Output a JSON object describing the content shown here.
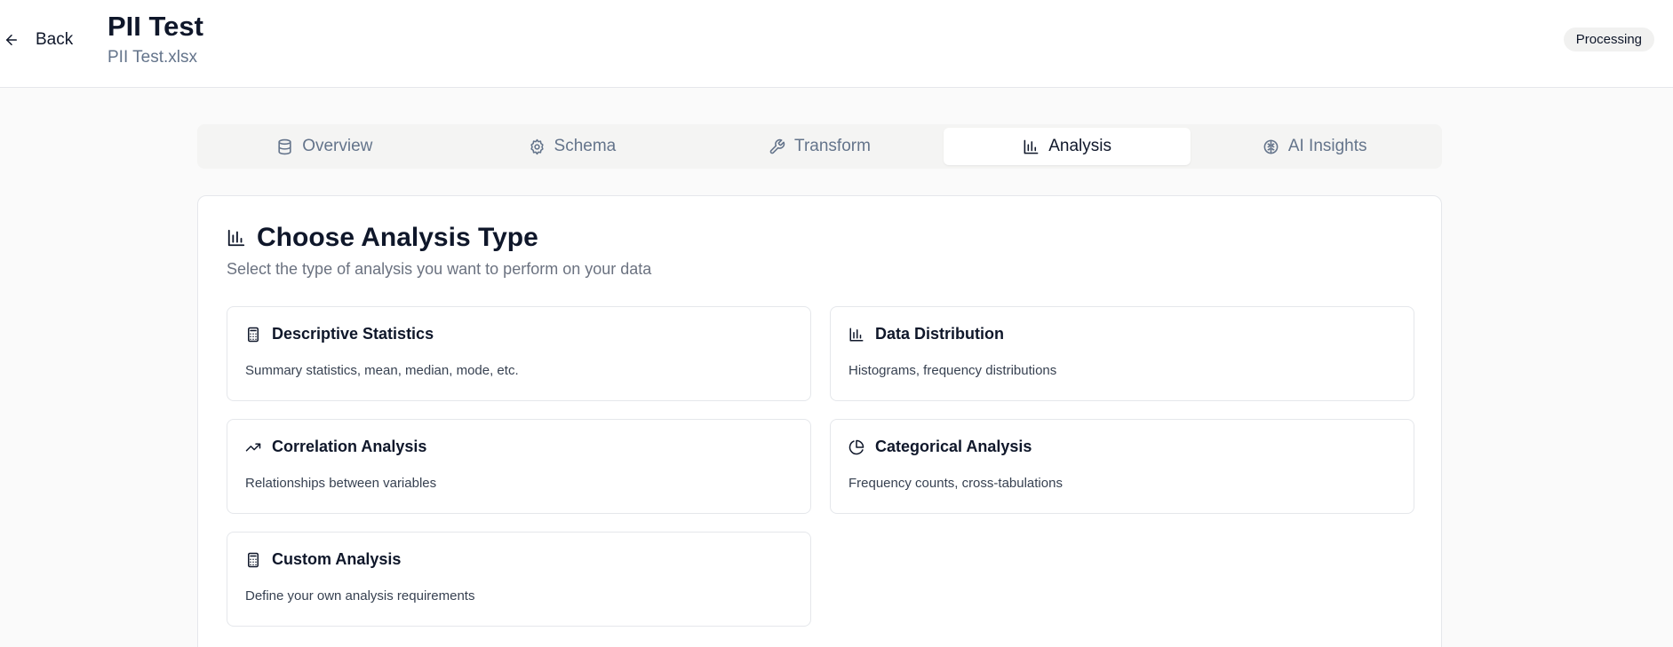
{
  "header": {
    "back_label": "Back",
    "title": "PII Test",
    "file_name": "PII Test.xlsx",
    "status": "Processing"
  },
  "tabs": [
    {
      "label": "Overview",
      "icon": "database-icon",
      "active": false
    },
    {
      "label": "Schema",
      "icon": "gear-icon",
      "active": false
    },
    {
      "label": "Transform",
      "icon": "wrench-icon",
      "active": false
    },
    {
      "label": "Analysis",
      "icon": "bar-chart-icon",
      "active": true
    },
    {
      "label": "AI Insights",
      "icon": "brain-icon",
      "active": false
    }
  ],
  "analysis": {
    "title": "Choose Analysis Type",
    "description": "Select the type of analysis you want to perform on your data",
    "options": [
      {
        "title": "Descriptive Statistics",
        "description": "Summary statistics, mean, median, mode, etc.",
        "icon": "calculator-icon"
      },
      {
        "title": "Data Distribution",
        "description": "Histograms, frequency distributions",
        "icon": "bar-chart-icon"
      },
      {
        "title": "Correlation Analysis",
        "description": "Relationships between variables",
        "icon": "trending-up-icon"
      },
      {
        "title": "Categorical Analysis",
        "description": "Frequency counts, cross-tabulations",
        "icon": "pie-chart-icon"
      },
      {
        "title": "Custom Analysis",
        "description": "Define your own analysis requirements",
        "icon": "calculator-icon"
      }
    ]
  },
  "colors": {
    "text_primary": "#0f172a",
    "text_muted": "#64748b",
    "border": "#e5e7eb",
    "tab_bg": "#f4f4f3",
    "page_bg": "#fafafa"
  }
}
